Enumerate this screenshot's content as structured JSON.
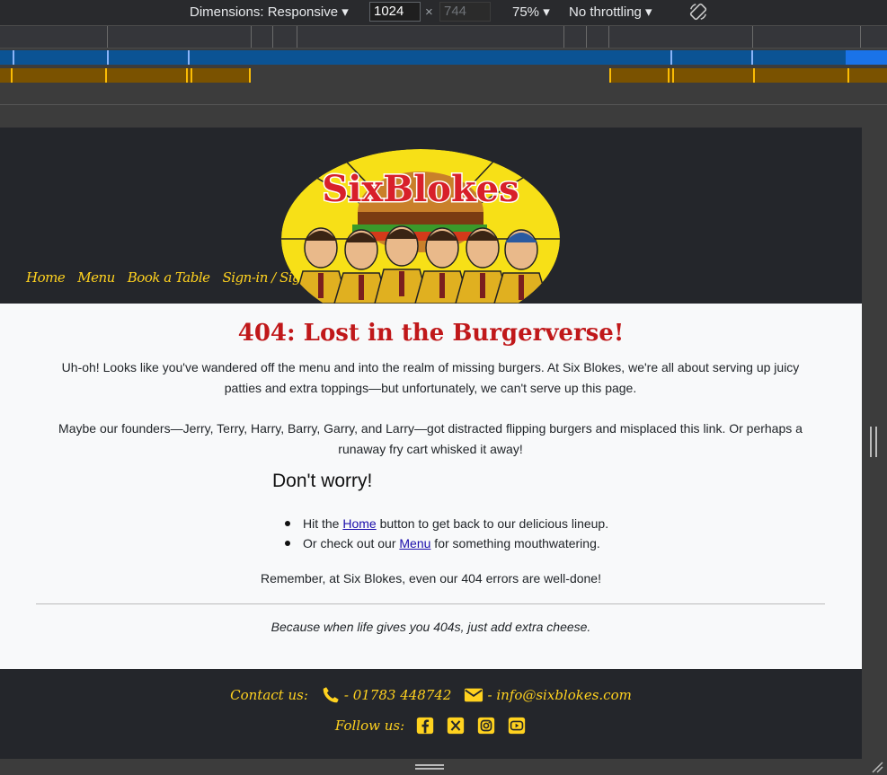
{
  "devtools": {
    "dimensions_label": "Dimensions: Responsive",
    "width": "1024",
    "height_placeholder": "744",
    "times": "×",
    "zoom": "75%",
    "throttling": "No throttling",
    "caret": "▾"
  },
  "site": {
    "logo_text": "SixBlokes",
    "nav": [
      "Home",
      "Menu",
      "Book a Table",
      "Sign-in / Sign-up"
    ]
  },
  "content": {
    "title": "404: Lost in the Burgerverse!",
    "paragraph1": "Uh-oh! Looks like you've wandered off the menu and into the realm of missing burgers. At Six Blokes, we're all about serving up juicy patties and extra toppings—but unfortunately, we can't serve up this page.",
    "paragraph2": "Maybe our founders—Jerry, Terry, Harry, Barry, Garry, and Larry—got distracted flipping burgers and misplaced this link. Or perhaps a runaway fry cart whisked it away!",
    "subheading": "Don't worry!",
    "bullet1_before": "Hit the ",
    "bullet1_link": "Home",
    "bullet1_after": " button to get back to our delicious lineup.",
    "bullet2_before": "Or check out our ",
    "bullet2_link": "Menu",
    "bullet2_after": " for something mouthwatering.",
    "remember": "Remember, at Six Blokes, even our 404 errors are well-done!",
    "quote": "Because when life gives you 404s, just add extra cheese."
  },
  "footer": {
    "contact_label": "Contact us:",
    "phone": "- 01783 448742",
    "email": "- info@sixblokes.com",
    "follow_label": "Follow us:",
    "social_icons": [
      "facebook-icon",
      "x-twitter-icon",
      "instagram-icon",
      "youtube-icon"
    ]
  },
  "colors": {
    "accent_yellow": "#ffd21f",
    "title_red": "#c0181a",
    "header_bg": "#24262b"
  }
}
